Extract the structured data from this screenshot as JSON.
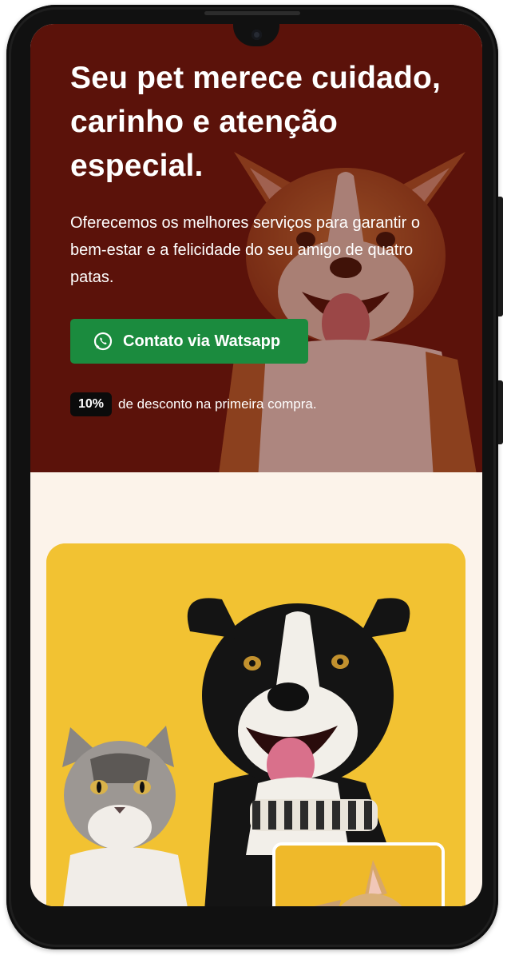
{
  "hero": {
    "title": "Seu pet merece cuidado, carinho e atenção especial.",
    "subtitle": "Oferecemos os melhores serviços para garantir o bem-estar e a felicidade do seu amigo de quatro patas.",
    "cta_label": "Contato via Watsapp",
    "cta_icon": "whatsapp-icon",
    "discount_badge": "10%",
    "discount_text": "de desconto na primeira compra."
  },
  "colors": {
    "hero_background": "#5b120a",
    "cta_green": "#1b8b3e",
    "page_background": "#fcf3ea",
    "photo_card_yellow": "#f2c232"
  }
}
